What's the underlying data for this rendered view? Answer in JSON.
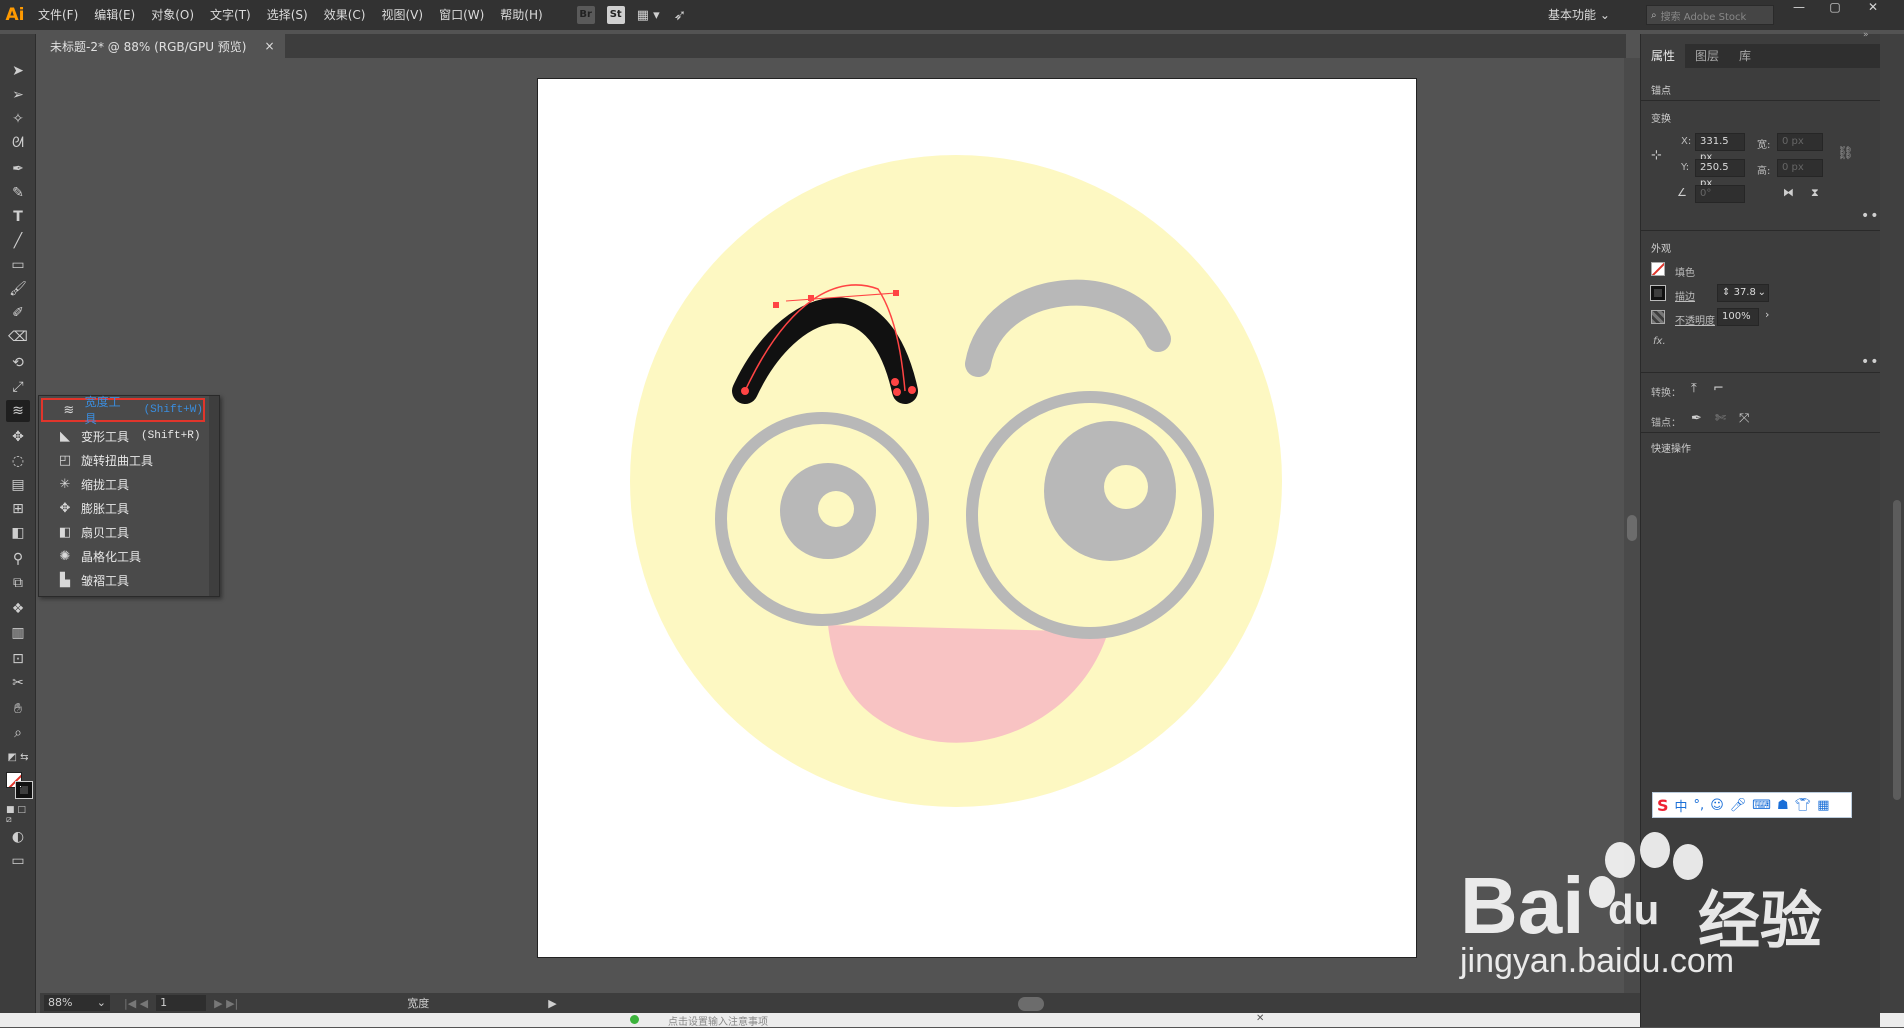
{
  "app": {
    "logo": "Ai"
  },
  "menu": [
    "文件(F)",
    "编辑(E)",
    "对象(O)",
    "文字(T)",
    "选择(S)",
    "效果(C)",
    "视图(V)",
    "窗口(W)",
    "帮助(H)"
  ],
  "menubar_icons": [
    "Br",
    "St"
  ],
  "workspace": "基本功能",
  "stock_search_placeholder": "搜索 Adobe Stock",
  "document": {
    "tab_title": "未标题-2* @ 88% (RGB/GPU 预览)",
    "close": "×"
  },
  "flyout": {
    "items": [
      {
        "label": "宽度工具",
        "shortcut": "(Shift+W)",
        "selected": true,
        "icon": "width-tool-icon"
      },
      {
        "label": "变形工具",
        "shortcut": "(Shift+R)",
        "selected": false,
        "icon": "warp-tool-icon"
      },
      {
        "label": "旋转扭曲工具",
        "shortcut": "",
        "selected": false,
        "icon": "twirl-tool-icon"
      },
      {
        "label": "缩拢工具",
        "shortcut": "",
        "selected": false,
        "icon": "pucker-tool-icon"
      },
      {
        "label": "膨胀工具",
        "shortcut": "",
        "selected": false,
        "icon": "bloat-tool-icon"
      },
      {
        "label": "扇贝工具",
        "shortcut": "",
        "selected": false,
        "icon": "scallop-tool-icon"
      },
      {
        "label": "晶格化工具",
        "shortcut": "",
        "selected": false,
        "icon": "crystallize-tool-icon"
      },
      {
        "label": "皱褶工具",
        "shortcut": "",
        "selected": false,
        "icon": "wrinkle-tool-icon"
      }
    ]
  },
  "status": {
    "zoom": "88%",
    "page": "1",
    "current_tool": "宽度"
  },
  "bottom_hint": "点击设置输入注意事项",
  "properties": {
    "tabs": [
      "属性",
      "图层",
      "库"
    ],
    "anchor_section": "锚点",
    "transform_section": "变换",
    "x_label": "X:",
    "x_value": "331.5 px",
    "y_label": "Y:",
    "y_value": "250.5 px",
    "w_label": "宽:",
    "w_value": "0 px",
    "h_label": "高:",
    "h_value": "0 px",
    "angle_value": "0°",
    "appearance_section": "外观",
    "fill_label": "填色",
    "stroke_label": "描边",
    "stroke_value": "37.8",
    "opacity_label": "不透明度",
    "opacity_value": "100%",
    "fx_label": "fx.",
    "convert_label": "转换：",
    "anchor_label": "锚点：",
    "quick_actions": "快速操作"
  },
  "ime": {
    "logo": "S",
    "lang": "中"
  },
  "watermark": {
    "brand": "Bai",
    "brand2": "du",
    "text": "经验",
    "url": "jingyan.baidu.com"
  },
  "colors": {
    "accent_red": "#e0352b",
    "selected_blue": "#3a8dde",
    "face_yellow": "#fdf8c2",
    "mouth_pink": "#f8c3c3",
    "eye_gray": "#bdbdbd"
  }
}
